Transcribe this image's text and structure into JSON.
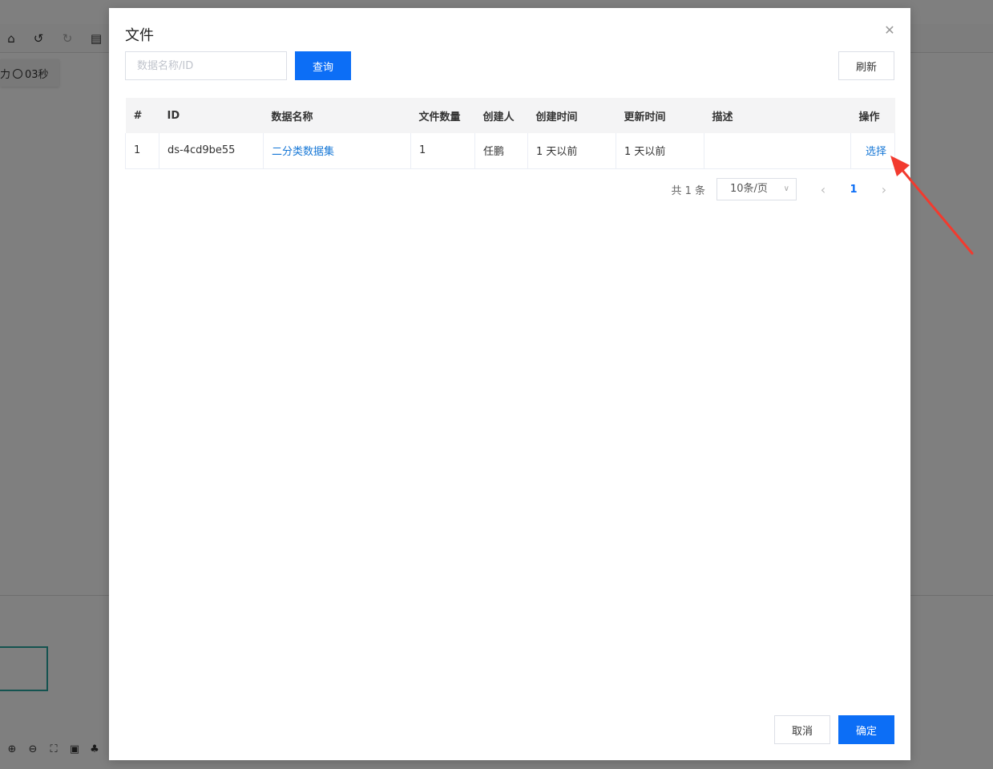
{
  "background": {
    "timer_text": "03秒",
    "timer_prefix": "力"
  },
  "modal": {
    "title": "文件",
    "close_icon": "close-icon",
    "search": {
      "placeholder": "数据名称/ID",
      "value": ""
    },
    "query_label": "查询",
    "refresh_label": "刷新",
    "table": {
      "headers": [
        "#",
        "ID",
        "数据名称",
        "文件数量",
        "创建人",
        "创建时间",
        "更新时间",
        "描述",
        "操作"
      ],
      "rows": [
        {
          "index": "1",
          "id": "ds-4cd9be55",
          "name": "二分类数据集",
          "file_count": "1",
          "creator": "任鹏",
          "created": "1 天以前",
          "updated": "1 天以前",
          "description": "",
          "action": "选择"
        }
      ]
    },
    "pagination": {
      "total": "共 1 条",
      "page_size": "10条/页",
      "current_page": "1"
    },
    "cancel_label": "取消",
    "ok_label": "确定"
  },
  "colors": {
    "primary": "#0c6ef6",
    "link": "#1677d6",
    "annotation_arrow": "#f23a2e"
  }
}
